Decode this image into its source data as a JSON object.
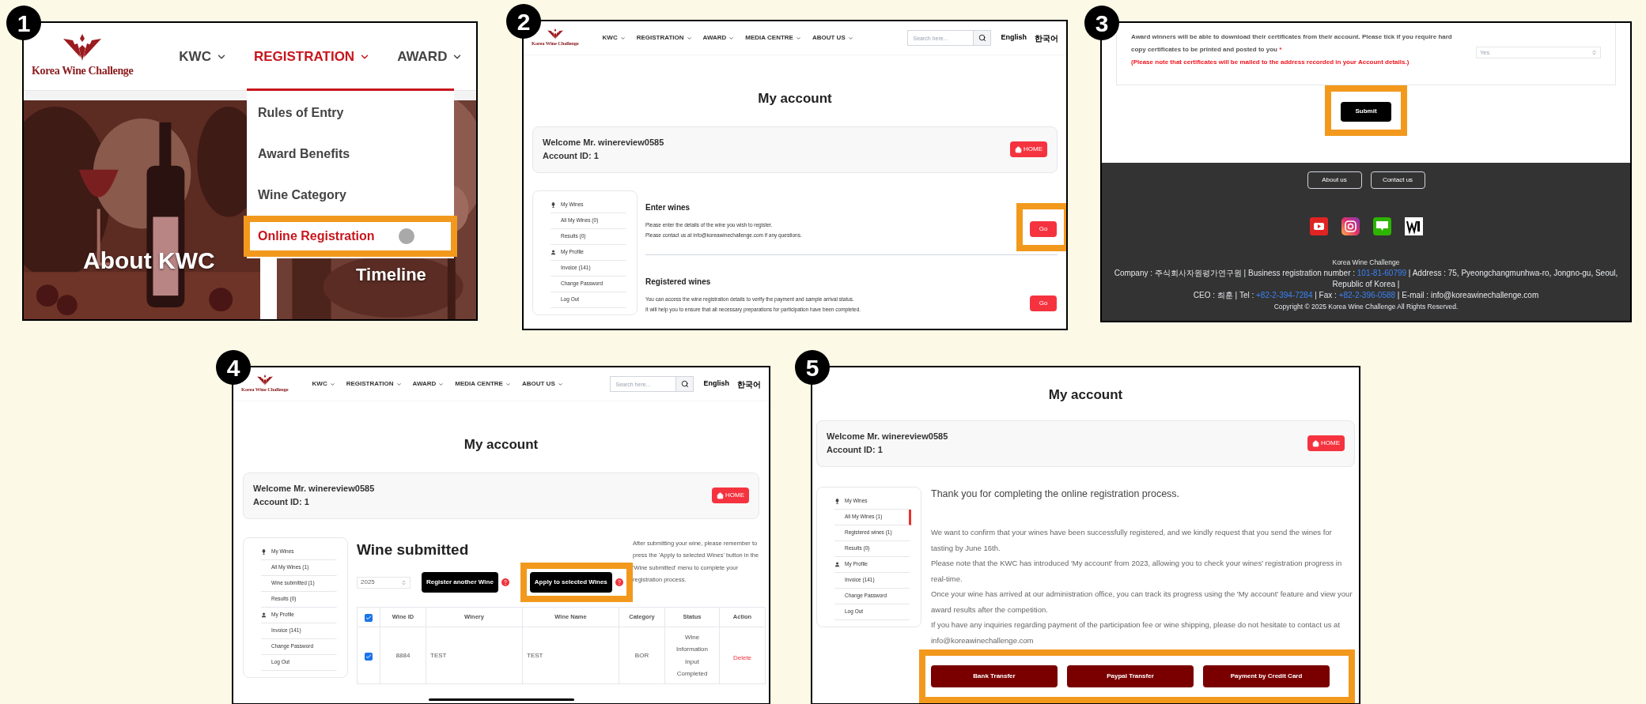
{
  "steps": [
    {
      "kind": "menu",
      "number": "1",
      "logo": "Korea Wine Challenge",
      "nav": [
        {
          "label": "KWC",
          "selected": false
        },
        {
          "label": "REGISTRATION",
          "selected": true
        },
        {
          "label": "AWARD",
          "selected": false
        }
      ],
      "dropdown": [
        {
          "label": "Rules of Entry",
          "selected": false,
          "highlighted": false
        },
        {
          "label": "Award Benefits",
          "selected": false,
          "highlighted": false
        },
        {
          "label": "Wine Category",
          "selected": false,
          "highlighted": false
        },
        {
          "label": "Online Registration",
          "selected": true,
          "highlighted": true
        }
      ],
      "captions": [
        "About KWC",
        "Timeline"
      ]
    },
    {
      "kind": "account_home",
      "number": "2",
      "header": {
        "logo": "Korea Wine Challenge",
        "nav": [
          {
            "label": "KWC"
          },
          {
            "label": "REGISTRATION"
          },
          {
            "label": "AWARD"
          },
          {
            "label": "MEDIA CENTRE"
          },
          {
            "label": "ABOUT US"
          }
        ],
        "search": {
          "placeholder": "Search here..."
        },
        "languages": [
          "English",
          "한국어"
        ]
      },
      "title": "My account",
      "account": {
        "welcome": "Welcome Mr. winereview0585",
        "account_id": "Account ID: 1",
        "home_button": "HOME"
      },
      "sidebar": [
        {
          "kind": "wines",
          "label": "My Wines",
          "selected": false
        },
        {
          "kind": "link",
          "label": "All My Wines (0)",
          "selected": false
        },
        {
          "kind": "link",
          "label": "Results (0)",
          "selected": false
        },
        {
          "kind": "profile",
          "label": "My Profile",
          "selected": false
        },
        {
          "kind": "link",
          "label": "Invoice (141)",
          "selected": false
        },
        {
          "kind": "link",
          "label": "Change Password",
          "selected": false
        },
        {
          "kind": "link",
          "label": "Log Out",
          "selected": false
        }
      ],
      "sections": [
        {
          "title": "Enter wines",
          "lines": [
            "Please enter the details of the wine you wish to register.",
            "Please contact us at info@koreawinechallenge.com if any questions."
          ],
          "button": {
            "label": "Go",
            "highlighted": true
          }
        },
        {
          "title": "Registered wines",
          "lines": [
            "You can access the wine registration details to verify the payment and sample arrival status.",
            "It will help you to ensure that all necessary preparations for participation have been completed."
          ],
          "button": {
            "label": "Go",
            "highlighted": false
          }
        }
      ]
    },
    {
      "kind": "submit",
      "number": "3",
      "form": {
        "question": "Award winners will be able to download their certificates from their account. Please tick if you require hard copy certificates to be printed and posted to you",
        "required_mark": "*",
        "note": "(Please note that certificates will be mailed to the address recorded in your Account details.)",
        "select": {
          "value": "Yes"
        }
      },
      "submit": {
        "label": "Submit",
        "highlighted": true
      },
      "footer": {
        "buttons": [
          "About us",
          "Contact us"
        ],
        "name": "Korea Wine Challenge",
        "lines": [
          [
            {
              "kind": "plain",
              "text": "Company : 주식회사자원평가연구원 | Business registration number : "
            },
            {
              "kind": "link",
              "text": "101-81-60799"
            },
            {
              "kind": "plain",
              "text": " | Address : 75, Pyeongchangmunhwa-ro, Jongno-gu, Seoul, Republic of Korea |"
            }
          ],
          [
            {
              "kind": "plain",
              "text": "CEO : 최훈 | Tel : "
            },
            {
              "kind": "link",
              "text": "+82-2-394-7284"
            },
            {
              "kind": "plain",
              "text": " | Fax : "
            },
            {
              "kind": "link",
              "text": "+82-2-396-0588"
            },
            {
              "kind": "plain",
              "text": " | E-mail : info@koreawinechallenge.com"
            }
          ]
        ],
        "copyright": "Copyright © 2025 Korea Wine Challenge All Rights Reserved."
      }
    },
    {
      "kind": "wine_submitted",
      "number": "4",
      "header": {
        "logo": "Korea Wine Challenge",
        "nav": [
          {
            "label": "KWC"
          },
          {
            "label": "REGISTRATION"
          },
          {
            "label": "AWARD"
          },
          {
            "label": "MEDIA CENTRE"
          },
          {
            "label": "ABOUT US"
          }
        ],
        "search": {
          "placeholder": "Search here..."
        },
        "languages": [
          "English",
          "한국어"
        ]
      },
      "title": "My account",
      "account": {
        "welcome": "Welcome Mr. winereview0585",
        "account_id": "Account ID: 1",
        "home_button": "HOME"
      },
      "sidebar": [
        {
          "kind": "wines",
          "label": "My Wines",
          "selected": false
        },
        {
          "kind": "link",
          "label": "All My Wines (1)",
          "selected": false
        },
        {
          "kind": "link",
          "label": "Wine submitted (1)",
          "selected": false
        },
        {
          "kind": "link",
          "label": "Results (0)",
          "selected": false
        },
        {
          "kind": "profile",
          "label": "My Profile",
          "selected": false
        },
        {
          "kind": "link",
          "label": "Invoice (141)",
          "selected": false
        },
        {
          "kind": "link",
          "label": "Change Password",
          "selected": false
        },
        {
          "kind": "link",
          "label": "Log Out",
          "selected": false
        }
      ],
      "heading": "Wine submitted",
      "year_select": {
        "value": "2025"
      },
      "buttons": [
        {
          "label": "Register another Wine",
          "highlighted": false
        },
        {
          "label": "Apply to selected Wines",
          "highlighted": true
        }
      ],
      "help_text": "After submitting your wine, please remember to press the 'Apply to selected Wines' button in the 'Wine submitted' menu to complete your registration process.",
      "table": {
        "select_all_checked": true,
        "columns": [
          "Wine ID",
          "Winery",
          "Wine Name",
          "Category",
          "Status",
          "Action"
        ],
        "rows": [
          {
            "checked": true,
            "cells": [
              "8884",
              "TEST",
              "TEST",
              "BOR",
              "Wine Information Input Completed"
            ],
            "action": "Delete"
          }
        ]
      }
    },
    {
      "kind": "payment",
      "number": "5",
      "title": "My account",
      "account": {
        "welcome": "Welcome Mr. winereview0585",
        "account_id": "Account ID: 1",
        "home_button": "HOME"
      },
      "sidebar": [
        {
          "kind": "wines",
          "label": "My Wines",
          "selected": false
        },
        {
          "kind": "link",
          "label": "All My Wines (1)",
          "selected": true
        },
        {
          "kind": "link",
          "label": "Registered wines (1)",
          "selected": false
        },
        {
          "kind": "link",
          "label": "Results (0)",
          "selected": false
        },
        {
          "kind": "profile",
          "label": "My Profile",
          "selected": false
        },
        {
          "kind": "link",
          "label": "Invoice (141)",
          "selected": false
        },
        {
          "kind": "link",
          "label": "Change Password",
          "selected": false
        },
        {
          "kind": "link",
          "label": "Log Out",
          "selected": false
        }
      ],
      "thanks": "Thank you for completing the online registration process.",
      "paragraphs": [
        "We want to confirm that your wines have been successfully registered, and we kindly request that you send the wines for tasting by June 16th.",
        "Please note that the KWC has introduced 'My account' from 2023, allowing you to check your wines' registration progress in real-time.",
        "Once your wine has arrived at our administration office, you can track its progress using the 'My account' feature and view your award results after the competition.",
        "If you have any inquiries regarding payment of the participation fee or wine shipping, please do not hesitate to contact us at info@koreawinechallenge.com"
      ],
      "payment": {
        "highlighted": true,
        "buttons": [
          "Bank Transfer",
          "Paypal Transfer",
          "Payment by Credit Card"
        ]
      }
    }
  ]
}
